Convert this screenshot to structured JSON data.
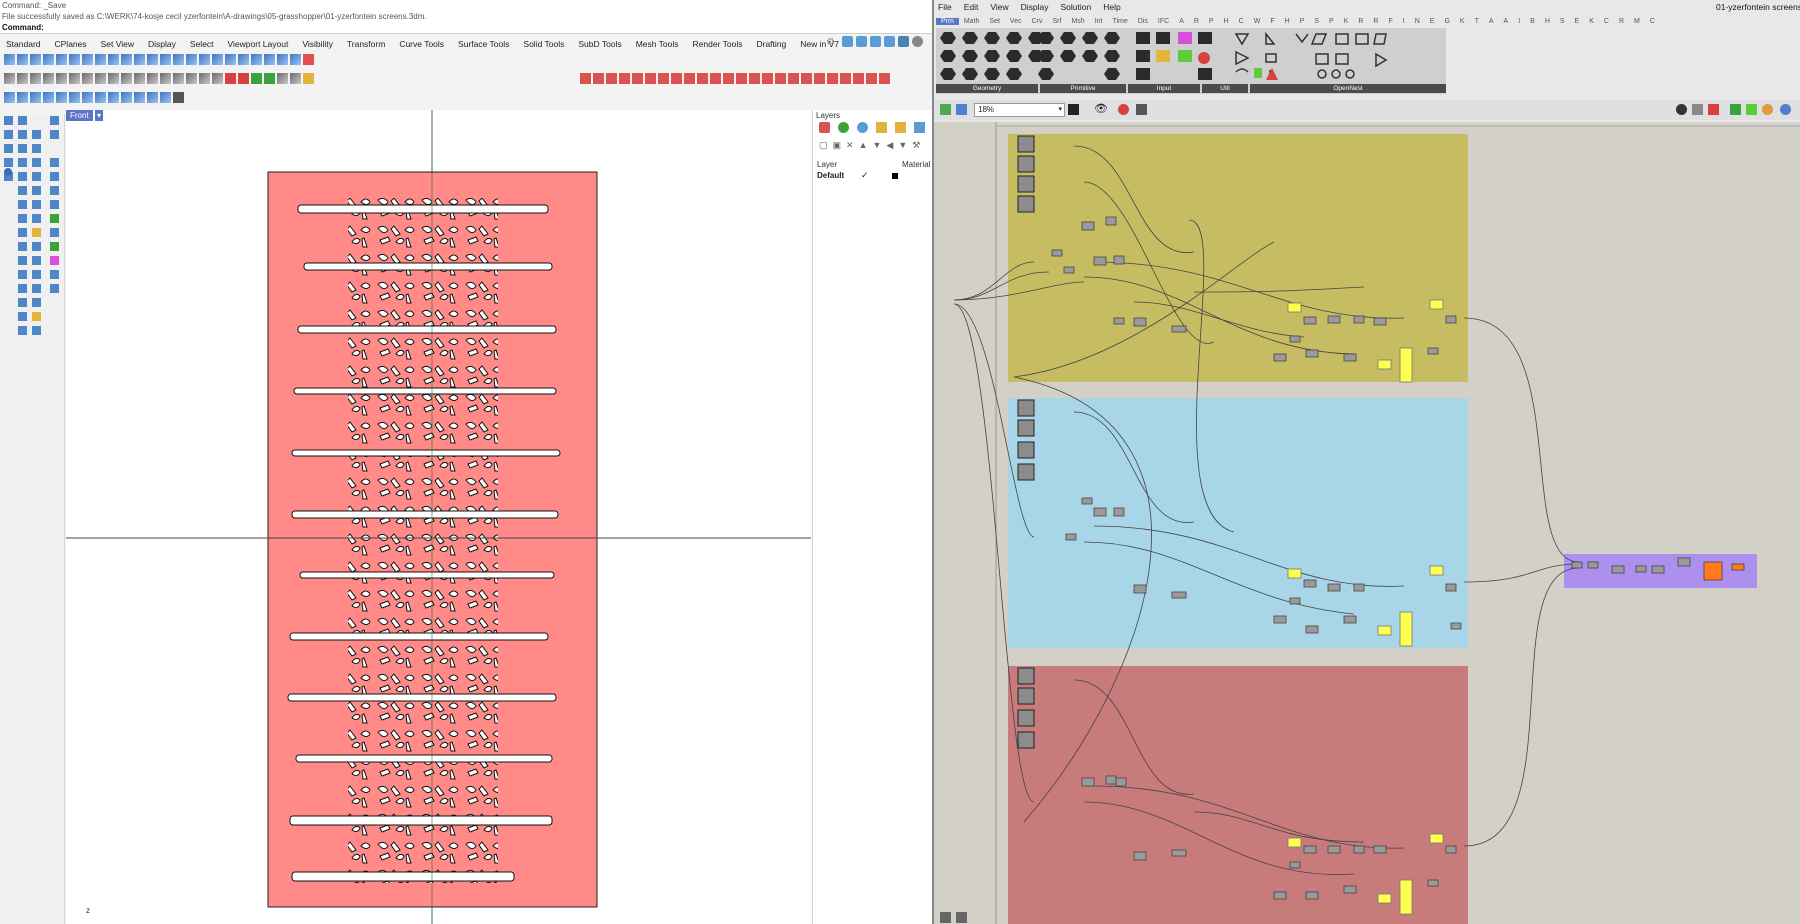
{
  "rhino": {
    "command_line_1": "Command: _Save",
    "command_line_2": "File successfully saved as C:\\WERK\\74-kosje cecil yzerfontein\\A-drawings\\05-grasshopper\\01-yzerfontein screens.3dm.",
    "command_prompt": "Command:",
    "tabs": [
      "Standard",
      "CPlanes",
      "Set View",
      "Display",
      "Select",
      "Viewport Layout",
      "Visibility",
      "Transform",
      "Curve Tools",
      "Surface Tools",
      "Solid Tools",
      "SubD Tools",
      "Mesh Tools",
      "Render Tools",
      "Drafting",
      "New in V7"
    ],
    "viewport_label": "Front",
    "axis_label": "z",
    "layers_title": "Layers",
    "layers_col_layer": "Layer",
    "layers_col_material": "Material",
    "layer_default": "Default",
    "colors": {
      "screen_fill": "#ff8a87",
      "viewport_bg": "#ffffff",
      "axis_green": "#2e8b2e"
    }
  },
  "grasshopper": {
    "title": "01-yzerfontein screens",
    "menu": [
      "File",
      "Edit",
      "View",
      "Display",
      "Solution",
      "Help"
    ],
    "tabs": [
      "Prm",
      "Math",
      "Set",
      "Vec",
      "Crv",
      "Srf",
      "Msh",
      "Int",
      "Time",
      "Dis",
      "IFC",
      "A",
      "R",
      "P",
      "H",
      "C",
      "W",
      "F",
      "H",
      "P",
      "S",
      "P",
      "K",
      "R",
      "R",
      "F",
      "I",
      "N",
      "E",
      "G",
      "K",
      "T",
      "A",
      "A",
      "I",
      "B",
      "H",
      "S",
      "E",
      "K",
      "C",
      "R",
      "M",
      "C"
    ],
    "ribbon_sections": [
      "Geometry",
      "Primitive",
      "Input",
      "Util",
      "OpenNest"
    ],
    "zoom": "18%",
    "colors": {
      "group_yellow": "#c6bd63",
      "group_blue": "#a8d6e8",
      "group_red": "#c87b7b",
      "group_purple": "#ad90ee",
      "canvas": "#d3d0c8",
      "panel_yellow": "#ffff50",
      "orange_node": "#ff7b1c"
    }
  }
}
